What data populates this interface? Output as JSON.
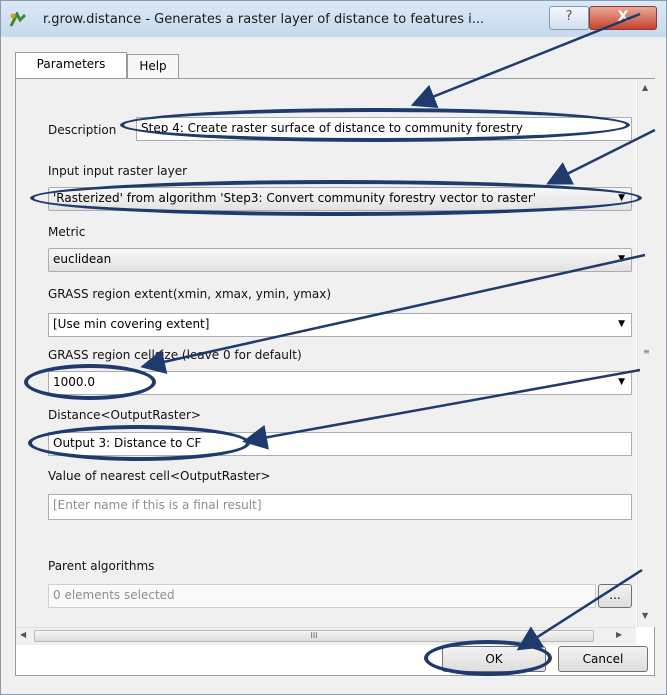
{
  "window": {
    "title": "r.grow.distance - Generates a raster layer of distance to features i...",
    "help_glyph": "?",
    "close_glyph": "X"
  },
  "tabs": [
    {
      "label": "Parameters"
    },
    {
      "label": "Help"
    }
  ],
  "form": {
    "description_label": "Description",
    "description_value": "Step 4: Create raster surface of distance to community forestry",
    "input_label": "Input input raster layer",
    "input_value": "'Rasterized' from algorithm 'Step3: Convert community forestry vector to raster'",
    "metric_label": "Metric",
    "metric_value": "euclidean",
    "extent_label": "GRASS region extent(xmin, xmax, ymin, ymax)",
    "extent_value": "[Use min covering extent]",
    "cellsize_label": "GRASS region cellsize (leave 0 for default)",
    "cellsize_value": "1000.0",
    "distance_label": "Distance<OutputRaster>",
    "distance_value": "Output 3: Distance to CF",
    "nearest_label": "Value of nearest cell<OutputRaster>",
    "nearest_placeholder": "[Enter name if this is a final result]",
    "parent_label": "Parent algorithms",
    "parent_value": "0 elements selected",
    "parent_button": "..."
  },
  "scroll": {
    "h_thumb_grip": "III"
  },
  "buttons": {
    "ok": "OK",
    "cancel": "Cancel"
  },
  "colors": {
    "annotation": "#1f3b6e"
  }
}
